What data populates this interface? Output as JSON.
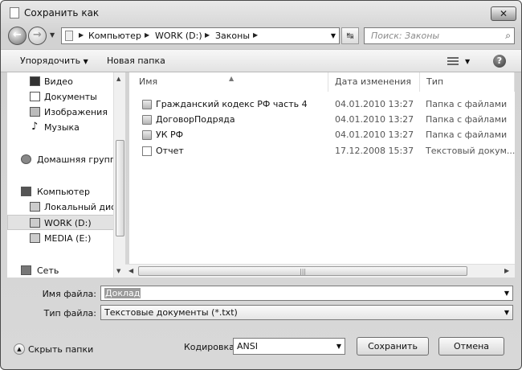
{
  "window": {
    "title": "Сохранить как"
  },
  "address": {
    "crumbs": [
      "Компьютер",
      "WORK (D:)",
      "Законы"
    ],
    "search_placeholder": "Поиск: Законы"
  },
  "toolbar": {
    "organize": "Упорядочить",
    "new_folder": "Новая папка"
  },
  "sidebar": {
    "items": [
      {
        "label": "Видео",
        "icon": "video-icon"
      },
      {
        "label": "Документы",
        "icon": "documents-icon"
      },
      {
        "label": "Изображения",
        "icon": "images-icon"
      },
      {
        "label": "Музыка",
        "icon": "music-icon"
      },
      {
        "label": "Домашняя группа",
        "icon": "homegroup-icon"
      },
      {
        "label": "Компьютер",
        "icon": "computer-icon"
      },
      {
        "label": "Локальный диск",
        "icon": "drive-icon"
      },
      {
        "label": "WORK (D:)",
        "icon": "drive-icon",
        "selected": true
      },
      {
        "label": "MEDIA (E:)",
        "icon": "drive-icon"
      },
      {
        "label": "Сеть",
        "icon": "network-icon"
      }
    ]
  },
  "columns": {
    "name": "Имя",
    "date": "Дата изменения",
    "type": "Тип"
  },
  "files": [
    {
      "name": "Гражданский кодекс РФ часть 4",
      "date": "04.01.2010 13:27",
      "type": "Папка с файлами",
      "kind": "folder"
    },
    {
      "name": "ДоговорПодряда",
      "date": "04.01.2010 13:27",
      "type": "Папка с файлами",
      "kind": "folder"
    },
    {
      "name": "УК РФ",
      "date": "04.01.2010 13:27",
      "type": "Папка с файлами",
      "kind": "folder"
    },
    {
      "name": "Отчет",
      "date": "17.12.2008 15:37",
      "type": "Текстовый докум...",
      "kind": "document"
    }
  ],
  "form": {
    "filename_label": "Имя файла:",
    "filename_value": "Доклад",
    "filetype_label": "Тип файла:",
    "filetype_value": "Текстовые документы (*.txt)",
    "hide_folders": "Скрыть папки",
    "encoding_label": "Кодировка:",
    "encoding_value": "ANSI",
    "save": "Сохранить",
    "cancel": "Отмена"
  }
}
